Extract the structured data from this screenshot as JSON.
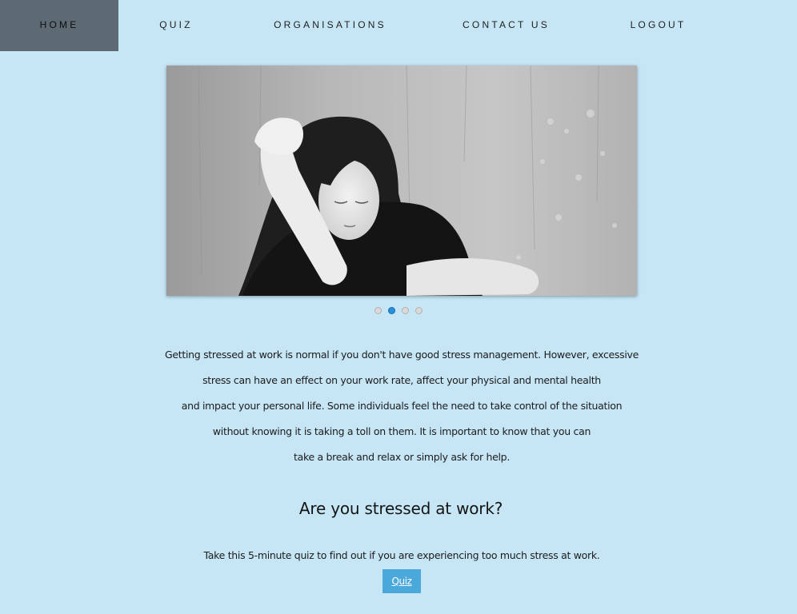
{
  "nav": {
    "home": "HOME",
    "quiz": "QUIZ",
    "organisations": "ORGANISATIONS",
    "contact": "CONTACT US",
    "logout": "LOGOUT"
  },
  "slider": {
    "dot_count": 4,
    "active_index": 1
  },
  "intro": {
    "lines": [
      "Getting stressed at work is normal if you don't have good stress management. However, excessive",
      "stress can have an effect on your work rate, affect your physical and mental health",
      "and impact your personal life. Some individuals feel the need to take control of the situation",
      "without knowing it is taking a toll on them. It is important to know that you can",
      "take a break and relax or simply ask for help."
    ]
  },
  "quiz_section": {
    "heading": "Are you stressed at work?",
    "note": "Take this 5-minute quiz to find out if you are experiencing too much stress at work.",
    "button": "Quiz"
  },
  "colors": {
    "background": "#c6e6f6",
    "nav_active": "#5d6a73",
    "button": "#4aa8db",
    "dot_active": "#2a8fd8"
  }
}
